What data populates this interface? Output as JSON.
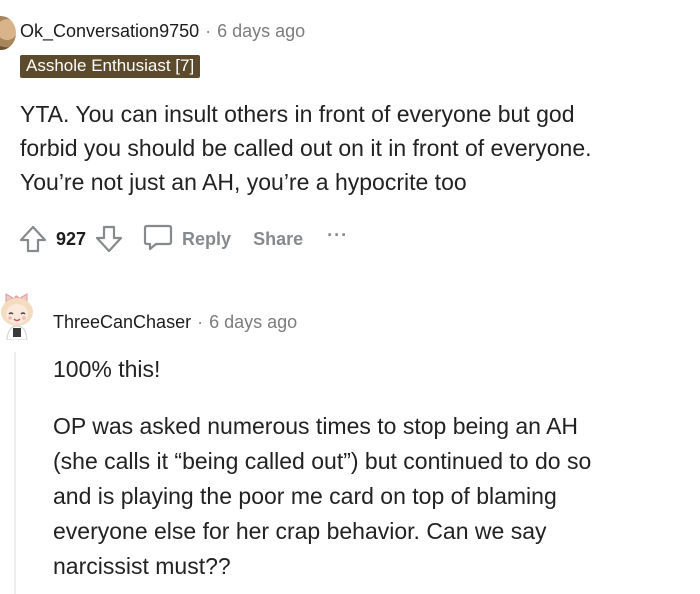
{
  "comment1": {
    "username": "Ok_Conversation9750",
    "separator": "·",
    "time": "6 days ago",
    "flair": "Asshole Enthusiast [7]",
    "body_lines": [
      "YTA. You can insult others in front of everyone but god",
      "forbid you should be called out on it in front of everyone.",
      "You’re not just an AH, you’re a hypocrite too"
    ],
    "score": "927",
    "actions": {
      "reply": "Reply",
      "share": "Share",
      "more": "···"
    }
  },
  "comment2": {
    "username": "ThreeCanChaser",
    "separator": "·",
    "time": "6 days ago",
    "paragraph1": "100% this!",
    "paragraph2_lines": [
      "OP was asked numerous times to stop being an AH",
      "(she calls it “being called out”) but continued to do so",
      "and is playing the poor me card on top of blaming",
      "everyone else for her crap behavior. Can we say",
      "narcissist must??"
    ]
  },
  "colors": {
    "flair_bg": "#5b4a2b",
    "meta_gray": "#878a8c",
    "text": "#222222",
    "thread_line": "#ededed"
  },
  "icons": [
    "upvote-icon",
    "downvote-icon",
    "comment-bubble-icon",
    "more-options-icon"
  ]
}
